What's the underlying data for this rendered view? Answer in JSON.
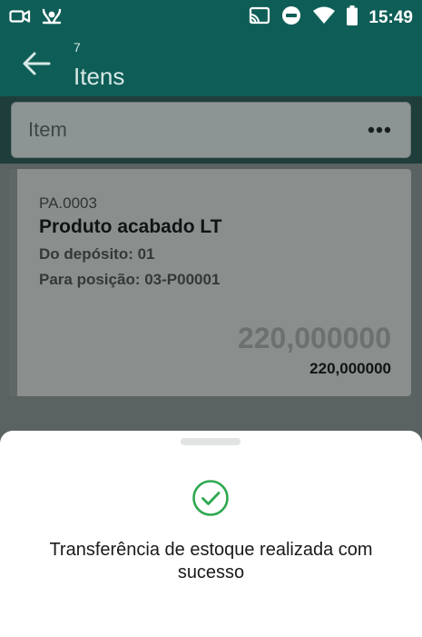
{
  "status_bar": {
    "time": "15:49",
    "icons_left": [
      "video-camera-icon",
      "mute-vibrate-icon"
    ],
    "icons_right": [
      "cast-icon",
      "do-not-disturb-icon",
      "wifi-icon",
      "battery-icon"
    ]
  },
  "header": {
    "count": "7",
    "title": "Itens",
    "back_icon": "arrow-left-icon"
  },
  "search": {
    "placeholder": "Item",
    "menu_icon": "more-horizontal-icon"
  },
  "items": [
    {
      "code": "PA.0003",
      "name": "Produto acabado LT",
      "from": "Do depósito: 01",
      "to": "Para posição: 03-P00001",
      "quantity_main": "220,000000",
      "quantity_secondary": "220,000000"
    }
  ],
  "bottom_sheet": {
    "message": "Transferência de estoque realizada com sucesso",
    "icon": "check-circle-icon",
    "success_color": "#2ea84f"
  },
  "colors": {
    "primary": "#0e5e57"
  }
}
